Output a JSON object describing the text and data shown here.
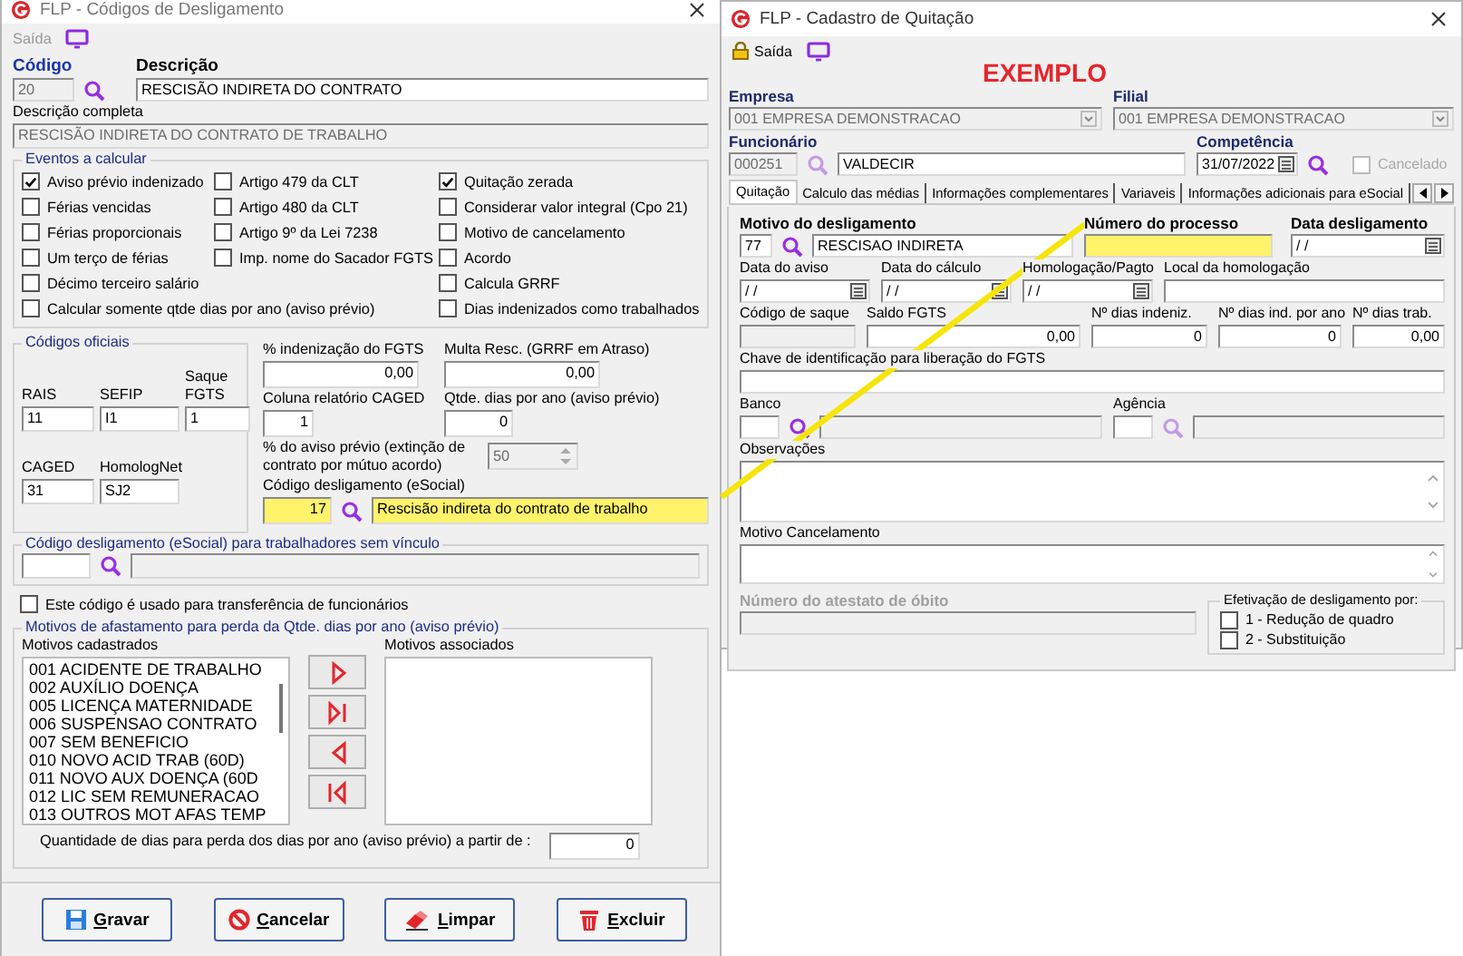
{
  "codigos_window": {
    "title": "FLP - Códigos de Desligamento",
    "toolbar": {
      "exit": "Saída",
      "disabled": true
    },
    "codigo": {
      "label": "Código",
      "value": "20",
      "disabled": true
    },
    "descricao": {
      "label": "Descrição",
      "value": "RESCISÃO INDIRETA DO CONTRATO"
    },
    "descricao_completa": {
      "label": "Descrição completa",
      "value": "RESCISÃO INDIRETA DO CONTRATO DE TRABALHO",
      "disabled": true
    },
    "eventos": {
      "title": "Eventos a calcular",
      "rows": [
        [
          {
            "label": "Aviso prévio indenizado",
            "checked": true
          },
          {
            "label": "Artigo 479 da CLT",
            "checked": false
          },
          {
            "label": "Quitação zerada",
            "checked": true
          }
        ],
        [
          {
            "label": "Férias vencidas",
            "checked": false
          },
          {
            "label": "Artigo 480 da CLT",
            "checked": false
          },
          {
            "label": "Considerar valor integral (Cpo 21)",
            "checked": false
          }
        ],
        [
          {
            "label": "Férias proporcionais",
            "checked": false
          },
          {
            "label": "Artigo 9º da Lei 7238",
            "checked": false
          },
          {
            "label": "Motivo de cancelamento",
            "checked": false
          }
        ],
        [
          {
            "label": "Um terço de férias",
            "checked": false
          },
          {
            "label": "Imp. nome do Sacador FGTS",
            "checked": false
          },
          {
            "label": "Acordo",
            "checked": false
          }
        ],
        [
          {
            "label": "Décimo terceiro salário",
            "checked": false
          },
          {
            "label": "Calcula GRRF",
            "checked": false
          }
        ],
        [
          {
            "label": "Calcular somente qtde dias por ano (aviso prévio)",
            "checked": false
          },
          {
            "label": "Dias indenizados como trabalhados",
            "checked": false
          }
        ]
      ]
    },
    "codigos_oficiais": {
      "title": "Códigos oficiais",
      "fields": [
        {
          "label": "RAIS",
          "value": "11"
        },
        {
          "label": "SEFIP",
          "value": "I1"
        },
        {
          "label": "Saque FGTS",
          "value": "1"
        },
        {
          "label": "CAGED",
          "value": "31"
        },
        {
          "label": "HomologNet",
          "value": "SJ2"
        }
      ]
    },
    "numeric_fields": [
      {
        "label": "% indenização do FGTS",
        "value": "0,00"
      },
      {
        "label": "Multa Resc. (GRRF em Atraso)",
        "value": "0,00"
      },
      {
        "label": "Coluna relatório CAGED",
        "value": "1"
      },
      {
        "label": "Qtde. dias por ano (aviso prévio)",
        "value": "0"
      }
    ],
    "aviso_mutuo": {
      "label": "% do aviso prévio (extinção de contrato por mútuo acordo)",
      "value": "50",
      "disabled": true
    },
    "esocial": {
      "label": "Código desligamento (eSocial)",
      "code": "17",
      "description": "Rescisão indireta do contrato de trabalho",
      "highlighted": true
    },
    "sem_vinculo": {
      "title": "Código desligamento (eSocial) para trabalhadores sem vínculo"
    },
    "transferencia": {
      "label": "Este código é usado para transferência de funcionários",
      "checked": false
    },
    "motivos": {
      "title": "Motivos de afastamento para perda da Qtde. dias por ano (aviso prévio)",
      "cadastrados_label": "Motivos cadastrados",
      "cadastrados": [
        "001 ACIDENTE DE TRABALHO",
        "002 AUXÍLIO DOENÇA",
        "005 LICENÇA MATERNIDADE",
        "006 SUSPENSAO CONTRATO",
        "007 SEM BENEFICIO",
        "010 NOVO ACID TRAB (60D)",
        "011 NOVO AUX DOENÇA (60D",
        "012 LIC SEM REMUNERACAO",
        "013 OUTROS MOT AFAS TEMP"
      ],
      "associados_label": "Motivos associados",
      "quantidade": {
        "label": "Quantidade de dias para perda dos dias por ano (aviso prévio) a  partir de :",
        "value": "0"
      }
    },
    "buttons": [
      {
        "label": "Gravar",
        "kind": "save"
      },
      {
        "label": "Cancelar",
        "kind": "cancel"
      },
      {
        "label": "Limpar",
        "kind": "eraser"
      },
      {
        "label": "Excluir",
        "kind": "delete"
      }
    ]
  },
  "quitacao_window": {
    "title": "FLP - Cadastro de Quitação",
    "toolbar": {
      "exit": "Saída",
      "disabled": false
    },
    "example_label": "EXEMPLO",
    "empresa": {
      "label": "Empresa",
      "value": "001 EMPRESA DEMONSTRACAO",
      "disabled": true
    },
    "filial": {
      "label": "Filial",
      "value": "001 EMPRESA DEMONSTRACAO",
      "disabled": true
    },
    "funcionario": {
      "label": "Funcionário",
      "code": "000251",
      "name": "VALDECIR"
    },
    "competencia": {
      "label": "Competência",
      "value": "31/07/2022"
    },
    "cancelado": {
      "label": "Cancelado",
      "checked": false,
      "disabled": true
    },
    "tabs": [
      {
        "label": "Quitação",
        "selected": true
      },
      {
        "label": "Calculo das médias",
        "selected": false
      },
      {
        "label": "Informações complementares",
        "selected": false
      },
      {
        "label": "Variaveis",
        "selected": false
      },
      {
        "label": "Informações adicionais para eSocial",
        "selected": false
      }
    ],
    "motivo": {
      "label": "Motivo do desligamento",
      "code": "77",
      "description": "RESCISAO INDIRETA"
    },
    "numero_processo": {
      "label": "Número do processo",
      "highlighted": true
    },
    "data_desligamento": {
      "label": "Data desligamento",
      "value": "/ /"
    },
    "dates": [
      {
        "label": "Data do aviso",
        "value": "/ /"
      },
      {
        "label": "Data do cálculo",
        "value": "/ /"
      },
      {
        "label": "Homologação/Pagto",
        "value": "/ /"
      }
    ],
    "local_homologacao": {
      "label": "Local da homologação"
    },
    "valores": [
      {
        "label": "Código de saque",
        "disabled": true
      },
      {
        "label": "Saldo FGTS",
        "value": "0,00",
        "disabled": false
      },
      {
        "label": "Nº dias indeniz.",
        "value": "0",
        "disabled": false
      },
      {
        "label": "Nº dias ind. por ano",
        "value": "0",
        "disabled": false
      },
      {
        "label": "Nº dias trab.",
        "value": "0,00",
        "disabled": false
      }
    ],
    "chave_fgts": {
      "label": "Chave de identificação para liberação do FGTS"
    },
    "banco": {
      "label": "Banco"
    },
    "agencia": {
      "label": "Agência"
    },
    "observacoes": {
      "label": "Observações"
    },
    "motivo_cancelamento": {
      "label": "Motivo Cancelamento"
    },
    "atestado_obito": {
      "label": "Número do atestato de óbito",
      "disabled": true
    },
    "efetivacao": {
      "title": "Efetivação de desligamento por:",
      "options": [
        {
          "label": "1 - Redução de quadro",
          "checked": false
        },
        {
          "label": "2 - Substituição",
          "checked": false
        }
      ]
    }
  }
}
